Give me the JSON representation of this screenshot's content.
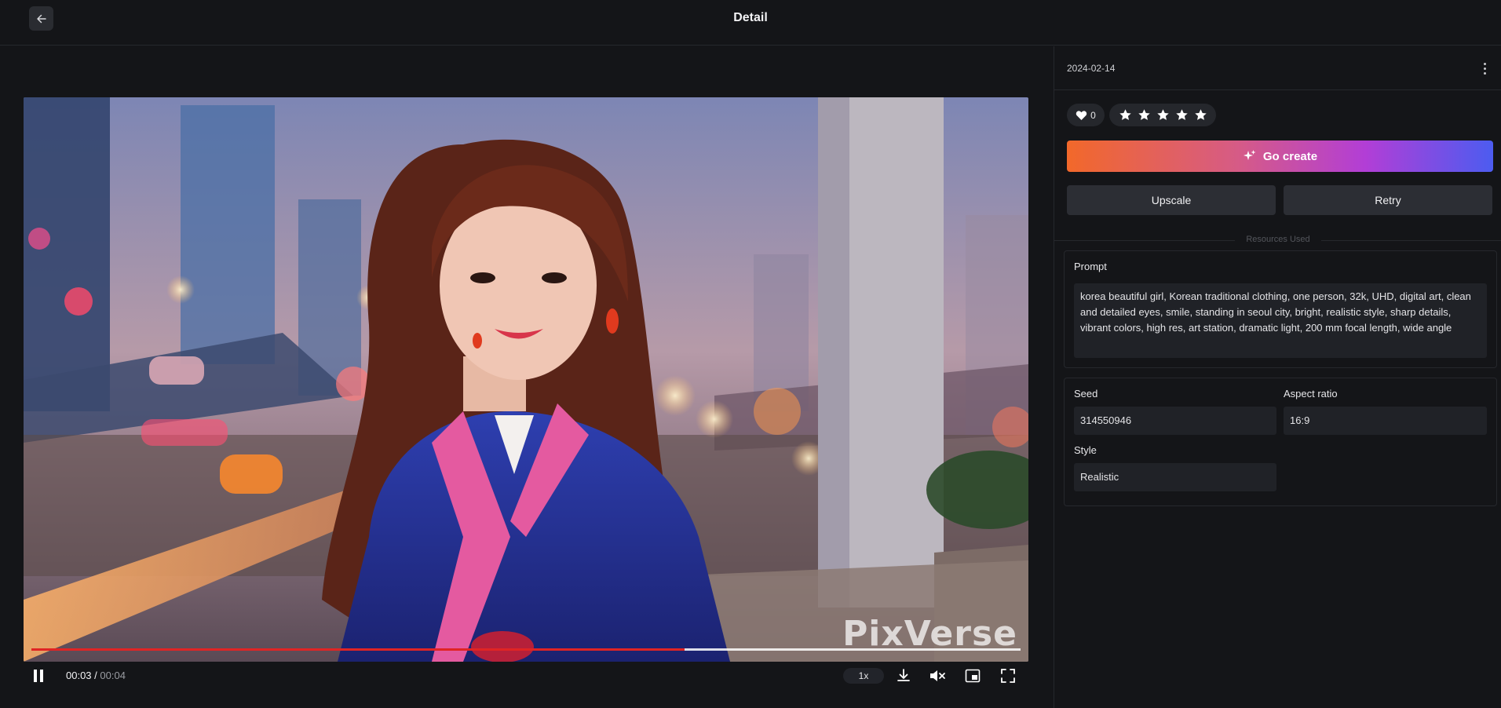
{
  "header": {
    "title": "Detail"
  },
  "video": {
    "watermark": "PixVerse",
    "current_time": "00:03",
    "separator": "/",
    "duration": "00:04",
    "progress": 0.66,
    "speed": "1x"
  },
  "details": {
    "date": "2024-02-14",
    "likes": "0",
    "rating_stars": 5,
    "go_create_label": "Go create",
    "upscale_label": "Upscale",
    "retry_label": "Retry",
    "resources_label": "Resources Used",
    "prompt_label": "Prompt",
    "prompt_text": "korea beautiful girl, Korean traditional clothing, one person, 32k, UHD, digital art, clean and detailed eyes, smile, standing in seoul city, bright, realistic style, sharp details, vibrant colors, high res, art station, dramatic light, 200 mm focal length, wide angle",
    "seed_label": "Seed",
    "seed_value": "314550946",
    "aspect_label": "Aspect ratio",
    "aspect_value": "16:9",
    "style_label": "Style",
    "style_value": "Realistic"
  },
  "colors": {
    "background": "#141518",
    "panel": "#202227",
    "progress": "#e02424",
    "gradient_start": "#f2682a",
    "gradient_end": "#4c5cf0"
  }
}
